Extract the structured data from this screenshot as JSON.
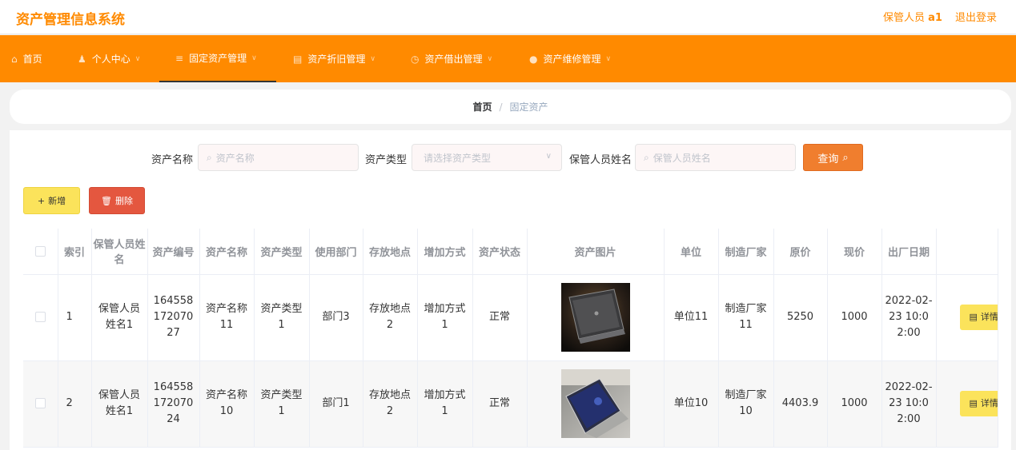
{
  "app": {
    "title": "资产管理信息系统"
  },
  "user": {
    "role": "保管人员",
    "name": "a1",
    "logout": "退出登录"
  },
  "nav": [
    {
      "label": "首页",
      "icon": "home-icon",
      "glyph": "⌂"
    },
    {
      "label": "个人中心",
      "icon": "user-icon",
      "glyph": "♟"
    },
    {
      "label": "固定资产管理",
      "icon": "list-icon",
      "glyph": "≡"
    },
    {
      "label": "资产折旧管理",
      "icon": "folder-icon",
      "glyph": "▤"
    },
    {
      "label": "资产借出管理",
      "icon": "clock-icon",
      "glyph": "◷"
    },
    {
      "label": "资产维修管理",
      "icon": "chat-icon",
      "glyph": "●"
    }
  ],
  "breadcrumb": {
    "home": "首页",
    "sep": "/",
    "current": "固定资产"
  },
  "search": {
    "name_label": "资产名称",
    "name_placeholder": "资产名称",
    "type_label": "资产类型",
    "type_placeholder": "请选择资产类型",
    "keeper_label": "保管人员姓名",
    "keeper_placeholder": "保管人员姓名",
    "query_label": "查询"
  },
  "actions": {
    "add_label": "新增",
    "delete_label": "删除"
  },
  "table": {
    "headers": [
      "索引",
      "保管人员姓名",
      "资产编号",
      "资产名称",
      "资产类型",
      "使用部门",
      "存放地点",
      "增加方式",
      "资产状态",
      "资产图片",
      "单位",
      "制造厂家",
      "原价",
      "现价",
      "出厂日期"
    ],
    "detail_label": "详情",
    "rows": [
      {
        "index": "1",
        "keeper": "保管人员姓名1",
        "code": "16455817207027",
        "name": "资产名称11",
        "type": "资产类型1",
        "dept": "部门3",
        "location": "存放地点2",
        "method": "增加方式1",
        "status": "正常",
        "unit": "单位11",
        "maker": "制造厂家11",
        "orig_price": "5250",
        "cur_price": "1000",
        "date": "2022-02-23 10:02:00"
      },
      {
        "index": "2",
        "keeper": "保管人员姓名1",
        "code": "16455817207024",
        "name": "资产名称10",
        "type": "资产类型1",
        "dept": "部门1",
        "location": "存放地点2",
        "method": "增加方式1",
        "status": "正常",
        "unit": "单位10",
        "maker": "制造厂家10",
        "orig_price": "4403.9",
        "cur_price": "1000",
        "date": "2022-02-23 10:02:00"
      }
    ]
  }
}
